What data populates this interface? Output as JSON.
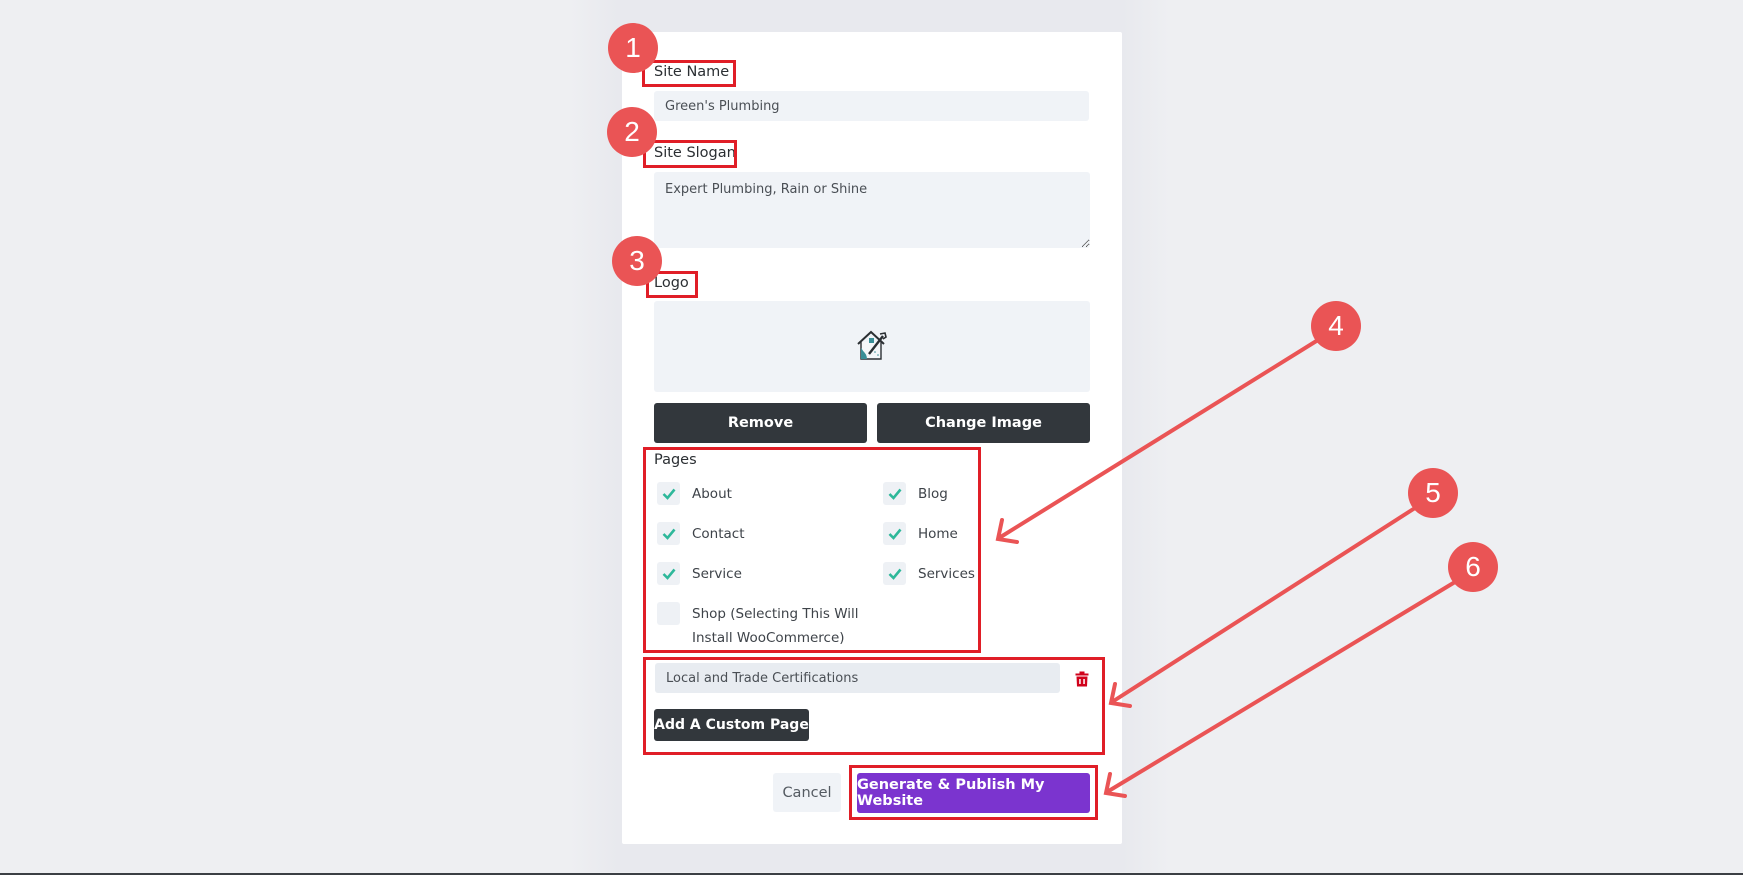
{
  "form": {
    "site_name": {
      "label": "Site Name",
      "value": "Green's Plumbing"
    },
    "site_slogan": {
      "label": "Site Slogan",
      "value": "Expert Plumbing, Rain or Shine"
    },
    "logo": {
      "label": "Logo",
      "image_icon": "house-plumbing-logo-icon"
    },
    "logo_buttons": {
      "remove": "Remove",
      "change": "Change Image"
    },
    "pages": {
      "label": "Pages",
      "items": [
        {
          "label": "About",
          "checked": true
        },
        {
          "label": "Blog",
          "checked": true
        },
        {
          "label": "Contact",
          "checked": true
        },
        {
          "label": "Home",
          "checked": true
        },
        {
          "label": "Service",
          "checked": true
        },
        {
          "label": "Services",
          "checked": true
        },
        {
          "label": "Shop (Selecting This Will Install WooCommerce)",
          "checked": false
        }
      ]
    },
    "custom_page": {
      "value": "Local and Trade Certifications",
      "delete_icon": "trash-icon",
      "add_label": "Add A Custom Page"
    },
    "actions": {
      "cancel": "Cancel",
      "generate": "Generate & Publish My Website"
    }
  },
  "annotations": {
    "badges": [
      "1",
      "2",
      "3",
      "4",
      "5",
      "6"
    ],
    "color": "#ea5455",
    "highlight_color": "#e01e27"
  },
  "colors": {
    "primary": "#7b34cf",
    "dark_button": "#32373c",
    "check": "#2eb89a",
    "danger": "#d0021b"
  }
}
